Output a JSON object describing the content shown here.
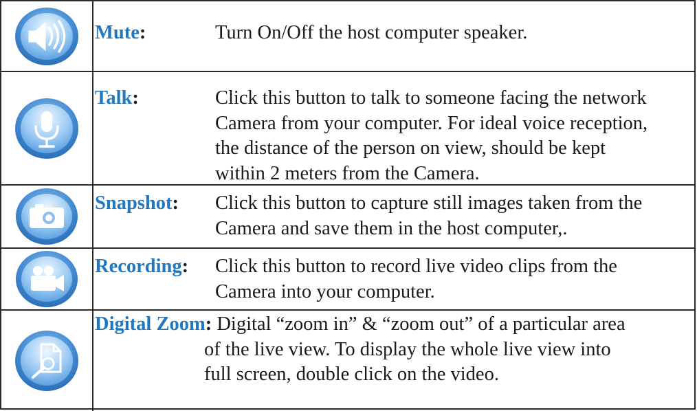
{
  "rows": [
    {
      "icon": "speaker-icon",
      "label": "Mute",
      "colon": ":",
      "lines": [
        "Turn On/Off the host computer speaker."
      ]
    },
    {
      "icon": "microphone-icon",
      "label": "Talk",
      "colon": ":",
      "lines": [
        "Click this button to talk to someone facing the network",
        "Camera from your computer. For ideal voice reception,",
        "the distance of the person on view, should be kept",
        "within 2 meters from the Camera."
      ]
    },
    {
      "icon": "camera-icon",
      "label": "Snapshot",
      "colon": ":",
      "lines": [
        "Click this button to capture still images taken from the",
        "Camera and save them in the host computer,."
      ]
    },
    {
      "icon": "video-camera-icon",
      "label": "Recording",
      "colon": ":",
      "lines": [
        "Click this button to record live video clips from the",
        "Camera into your computer."
      ]
    },
    {
      "icon": "digital-zoom-icon",
      "label": "Digital Zoom",
      "colon": ":",
      "first_line": "Digital “zoom in” & “zoom out” of a particular area",
      "lines": [
        "of the live view. To display the whole live view into",
        "full screen, double click on the video."
      ]
    }
  ],
  "colors": {
    "label": "#1f78c1",
    "icon_outer": "#4a90d9",
    "icon_inner": "#cfe6fb"
  }
}
